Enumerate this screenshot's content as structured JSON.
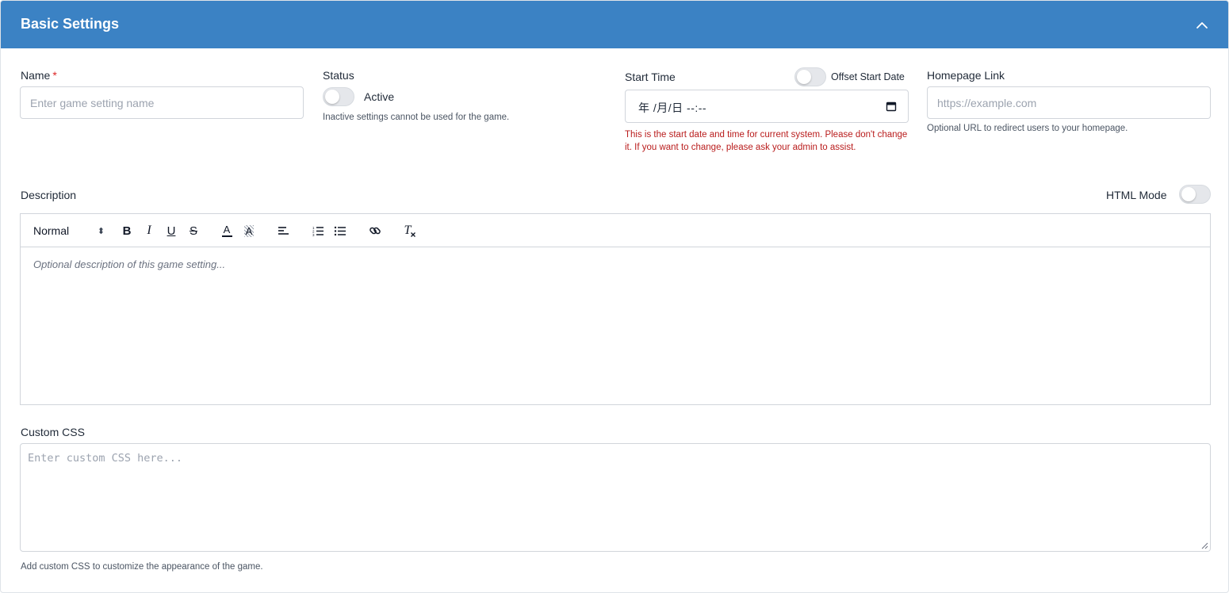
{
  "header": {
    "title": "Basic Settings",
    "collapse_icon": "chevron-up-icon"
  },
  "name_field": {
    "label": "Name",
    "required_mark": "*",
    "placeholder": "Enter game setting name"
  },
  "status_field": {
    "label": "Status",
    "toggle_label": "Active",
    "toggle_on": false,
    "help": "Inactive settings cannot be used for the game."
  },
  "start_time_field": {
    "label": "Start Time",
    "offset_toggle_label": "Offset Start Date",
    "offset_toggle_on": false,
    "value": "年 /月/日 --:--",
    "warning": "This is the start date and time for current system. Please don't change it. If you want to change, please ask your admin to assist."
  },
  "homepage_field": {
    "label": "Homepage Link",
    "placeholder": "https://example.com",
    "help": "Optional URL to redirect users to your homepage."
  },
  "description_field": {
    "label": "Description",
    "html_mode_label": "HTML Mode",
    "html_mode_on": false,
    "toolbar": {
      "format_select": "Normal",
      "format_select_chevron": "⬍",
      "bold": "B",
      "italic": "I",
      "underline": "U",
      "strike": "S",
      "text_color": "A",
      "background_color": "A",
      "clear_format": "T"
    },
    "placeholder": "Optional description of this game setting..."
  },
  "custom_css_field": {
    "label": "Custom CSS",
    "placeholder": "Enter custom CSS here...",
    "help": "Add custom CSS to customize the appearance of the game."
  },
  "colors": {
    "header_bg": "#3b82c4",
    "required": "#dc2626",
    "warning": "#b91c1c"
  }
}
